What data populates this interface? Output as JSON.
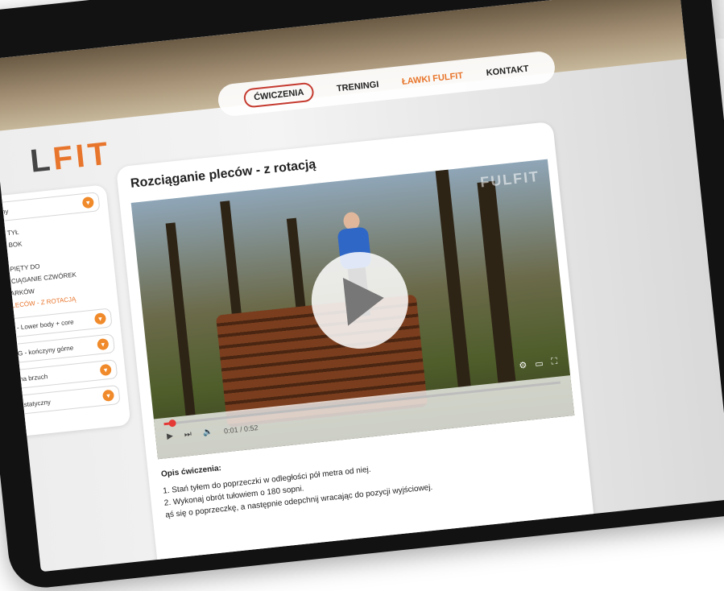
{
  "logo": {
    "left": "L",
    "right": "FIT"
  },
  "nav": {
    "items": [
      {
        "label": "ĆWICZENIA",
        "active": true
      },
      {
        "label": "TRENINGI"
      },
      {
        "label": "ŁAWKI FULFIT",
        "accent": true
      },
      {
        "label": "KONTAKT"
      }
    ]
  },
  "sidebar": {
    "category": "amiczny",
    "items": [
      {
        "label": "NÓG W TYŁ"
      },
      {
        "label": "NÓG W BOK"
      },
      {
        "label": "T"
      },
      {
        "label": "NIĘCIE PIĘTY DO"
      },
      {
        "label": "A - ROZCIĄGANIE CZWÓREK"
      },
      {
        "label": "ANIE BARKÓW"
      },
      {
        "label": "ANIE PLECÓW - Z ROTACJĄ",
        "active": true
      }
    ],
    "sections": [
      {
        "label": "nia LB - Lower body + core"
      },
      {
        "label": "enia KG - kończyny górne"
      },
      {
        "label": "zenia na brzuch"
      },
      {
        "label": "tching statyczny"
      }
    ]
  },
  "content": {
    "title": "Rozciąganie pleców - z rotacją",
    "watermark": "FULFIT",
    "video": {
      "time": "0:01 / 0:52",
      "progress_pct": 2
    },
    "description": {
      "heading": "Opis ćwiczenia:",
      "steps": [
        "1. Stań tyłem do poprzeczki w odległości pół metra od niej.",
        "2. Wykonaj obrót tułowiem o 180 sopni.",
        "ąś się o poprzeczkę, a następnie odepchnij wracając do pozycji wyjściowej."
      ]
    }
  }
}
